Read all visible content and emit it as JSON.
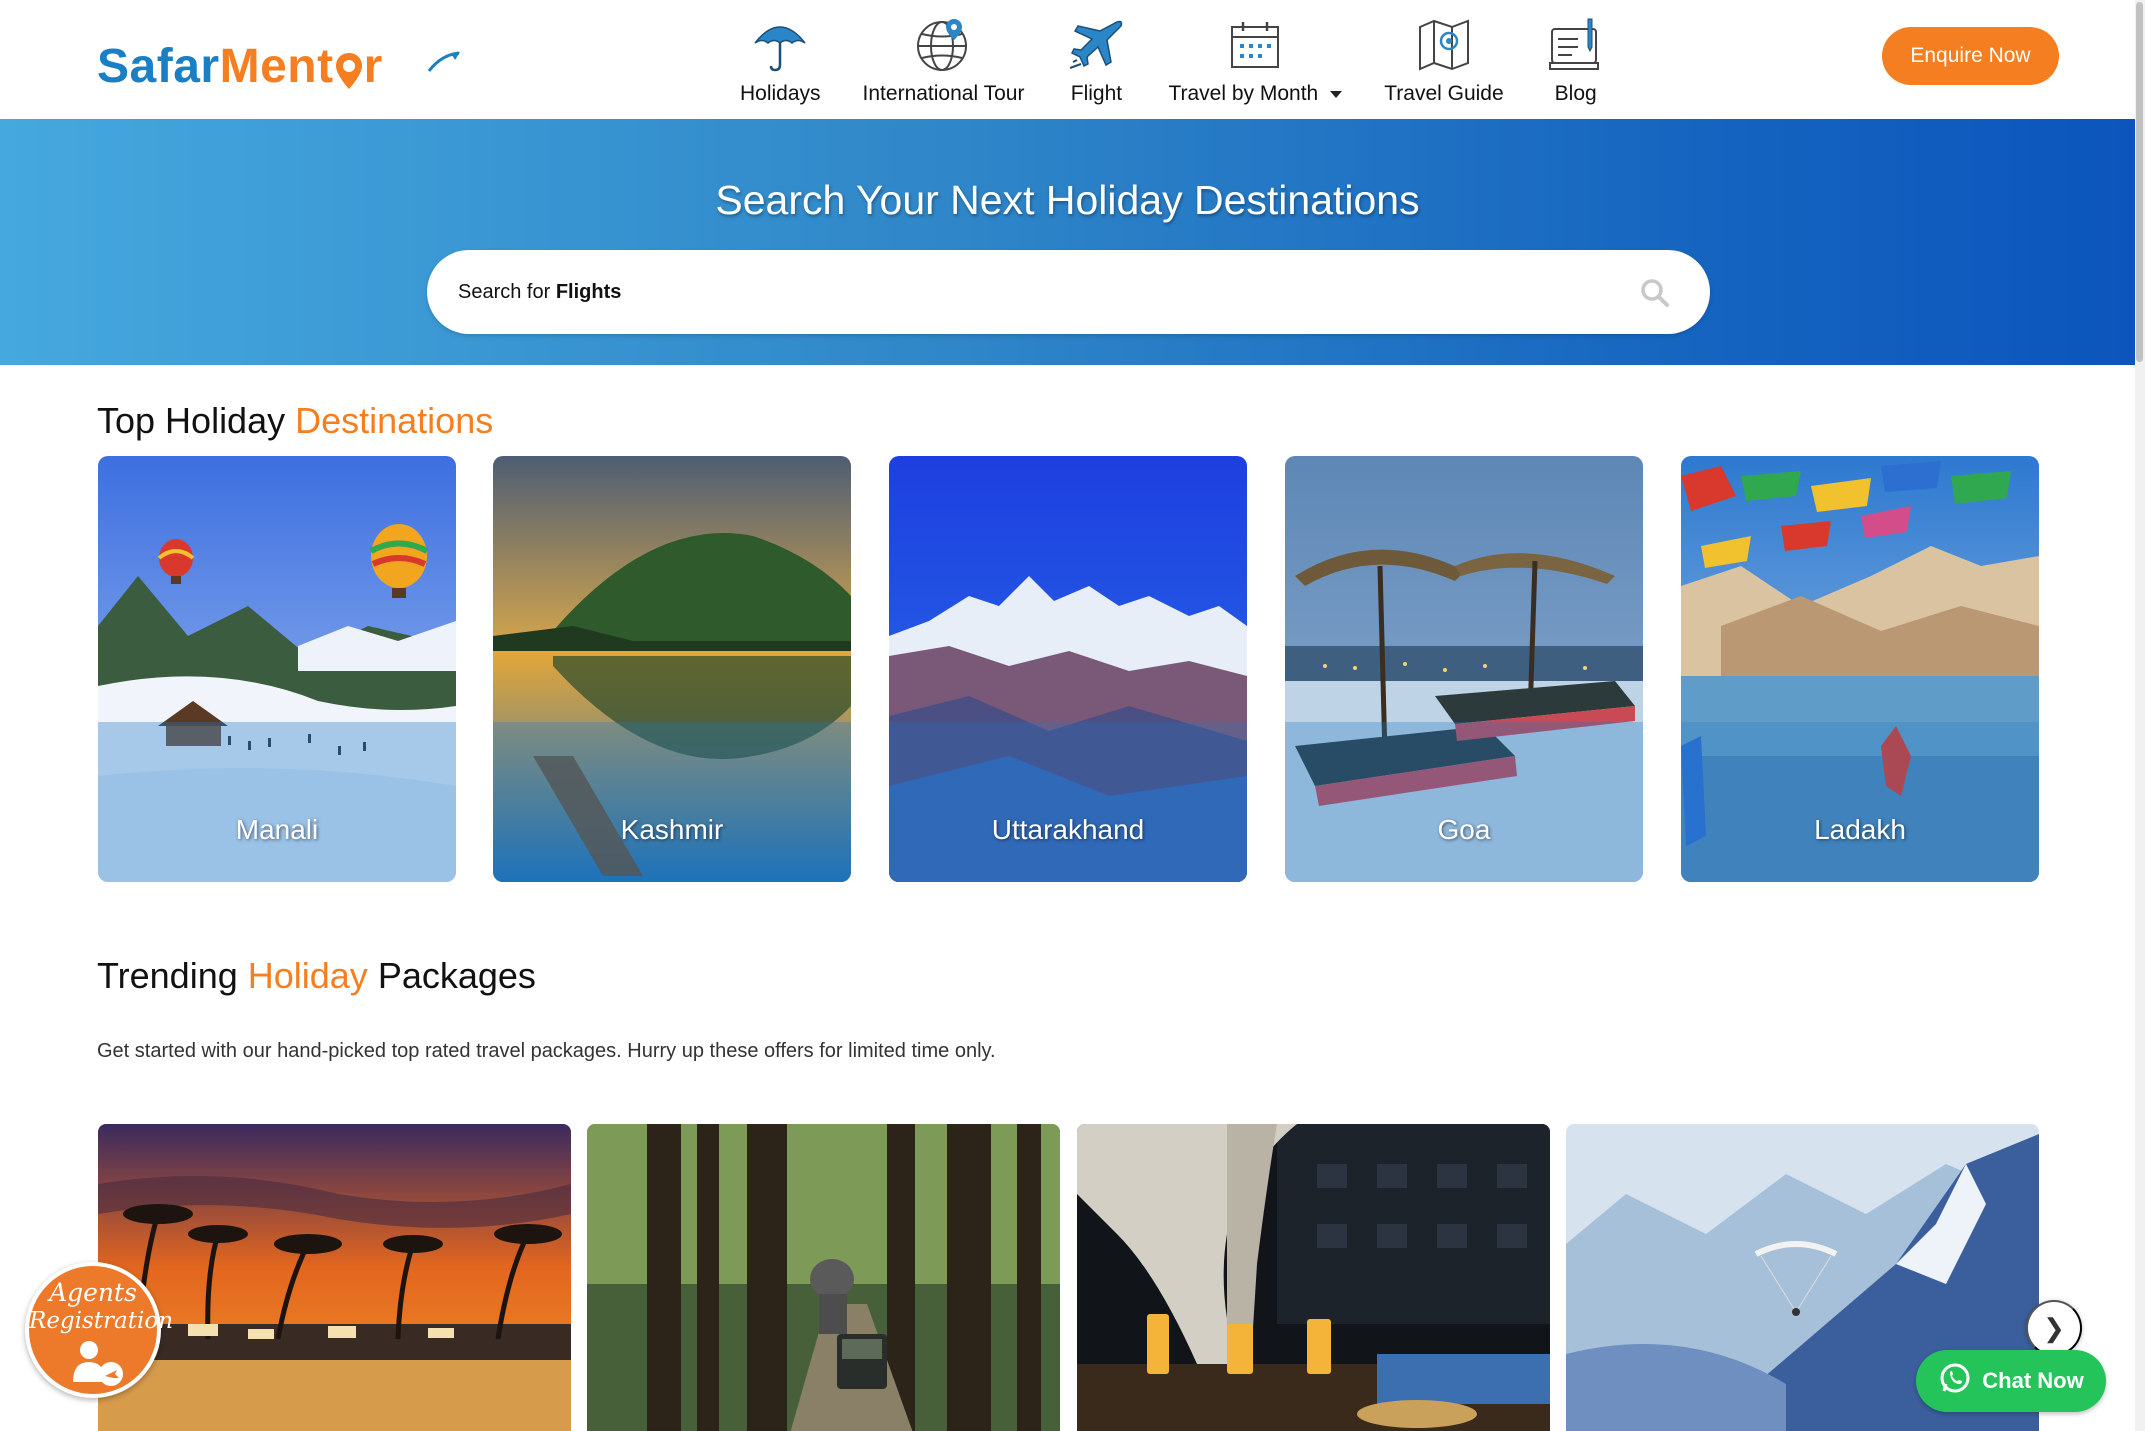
{
  "brand": {
    "name_part1": "Safar",
    "name_part2": "Ment",
    "name_part3": "r",
    "primary_color": "#1a7fc4",
    "accent_color": "#f57f20"
  },
  "nav": {
    "items": [
      {
        "label": "Holidays",
        "icon": "umbrella-icon"
      },
      {
        "label": "International Tour",
        "icon": "globe-icon"
      },
      {
        "label": "Flight",
        "icon": "airplane-icon"
      },
      {
        "label": "Travel by Month",
        "icon": "calendar-icon",
        "has_dropdown": true
      },
      {
        "label": "Travel Guide",
        "icon": "map-icon"
      },
      {
        "label": "Blog",
        "icon": "blog-icon"
      }
    ],
    "cta_label": "Enquire Now"
  },
  "hero": {
    "title": "Search Your Next Holiday Destinations",
    "search_placeholder_prefix": "Search for ",
    "search_placeholder_bold": "Flights"
  },
  "top_destinations": {
    "title_part1": "Top Holiday ",
    "title_part2": "Destinations",
    "cards": [
      {
        "name": "Manali"
      },
      {
        "name": "Kashmir"
      },
      {
        "name": "Uttarakhand"
      },
      {
        "name": "Goa"
      },
      {
        "name": "Ladakh"
      }
    ]
  },
  "trending": {
    "title_part1": "Trending ",
    "title_part2": "Holiday",
    "title_part3": " Packages",
    "subtitle": "Get started with our hand-picked top rated travel packages. Hurry up these offers for limited time only.",
    "next_arrow": "❯"
  },
  "floating": {
    "agents_line1": "Agents",
    "agents_line2": "Registration",
    "chat_label": "Chat Now",
    "chat_color": "#25c45a"
  }
}
